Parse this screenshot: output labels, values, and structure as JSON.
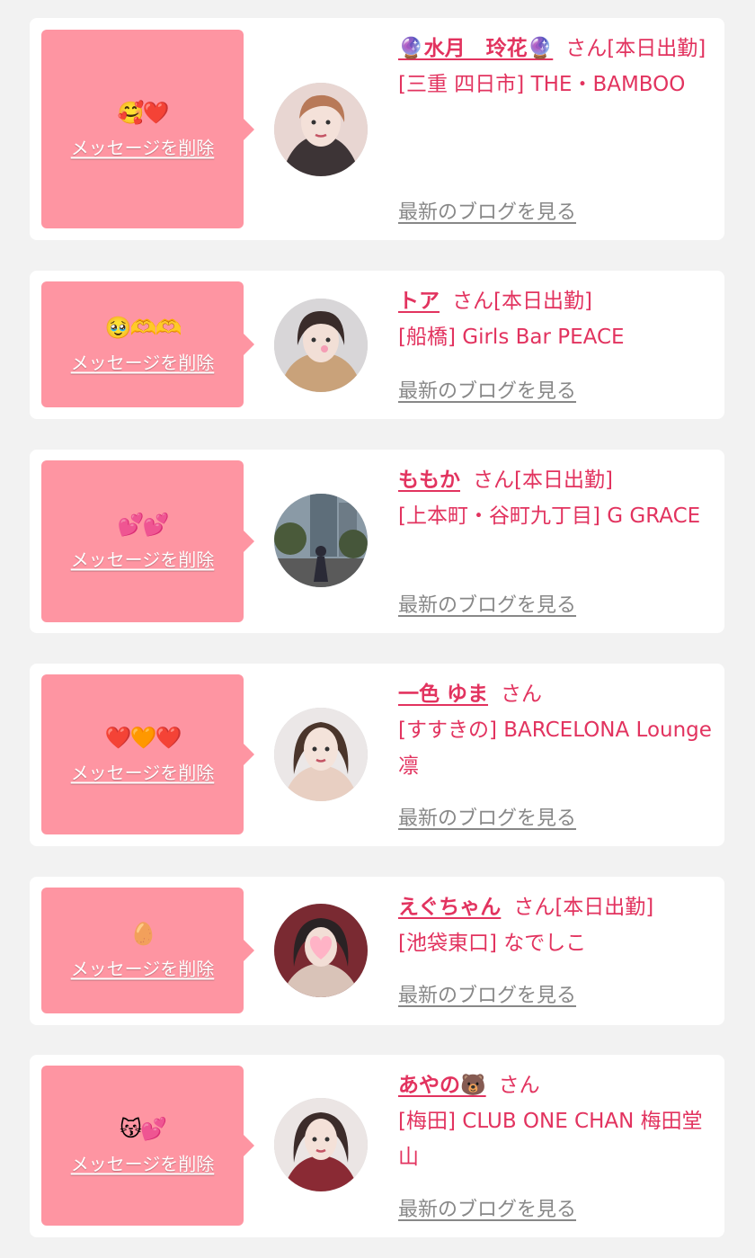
{
  "delete_label": "メッセージを削除",
  "blog_label": "最新のブログを見る",
  "colors": {
    "page_bg": "#f2f2f2",
    "card_bg": "#ffffff",
    "bubble_bg": "#fe95a2",
    "accent_text": "#e2335f",
    "link_grey": "#888888"
  },
  "messages": [
    {
      "emoji": "🥰❤️",
      "name": "🔮水月　玲花🔮",
      "san": "さん",
      "status": "[本日出勤]",
      "shop": "[三重 四日市] THE・BAMBOO",
      "avatar_icon": "woman-portrait"
    },
    {
      "emoji": "🥹🫶🫶",
      "name": "トア",
      "san": "さん",
      "status": "[本日出勤]",
      "shop": "[船橋] Girls Bar PEACE",
      "avatar_icon": "woman-portrait"
    },
    {
      "emoji": "💕💕",
      "name": "ももか",
      "san": "さん",
      "status": "[本日出勤]",
      "shop": "[上本町・谷町九丁目] G GRACE",
      "avatar_icon": "street-photo"
    },
    {
      "emoji": "❤️🧡❤️",
      "name": "一色 ゆま",
      "san": "さん",
      "status": "",
      "shop": "[すすきの] BARCELONA Lounge 凛",
      "avatar_icon": "woman-portrait"
    },
    {
      "emoji": "🥚",
      "name": "えぐちゃん",
      "san": "さん",
      "status": "[本日出勤]",
      "shop": "[池袋東口] なでしこ",
      "avatar_icon": "woman-portrait-heart-sticker"
    },
    {
      "emoji": "😽💕",
      "name": "あやの🐻",
      "san": "さん",
      "status": "",
      "shop": "[梅田] CLUB ONE CHAN 梅田堂山",
      "avatar_icon": "woman-portrait"
    }
  ]
}
